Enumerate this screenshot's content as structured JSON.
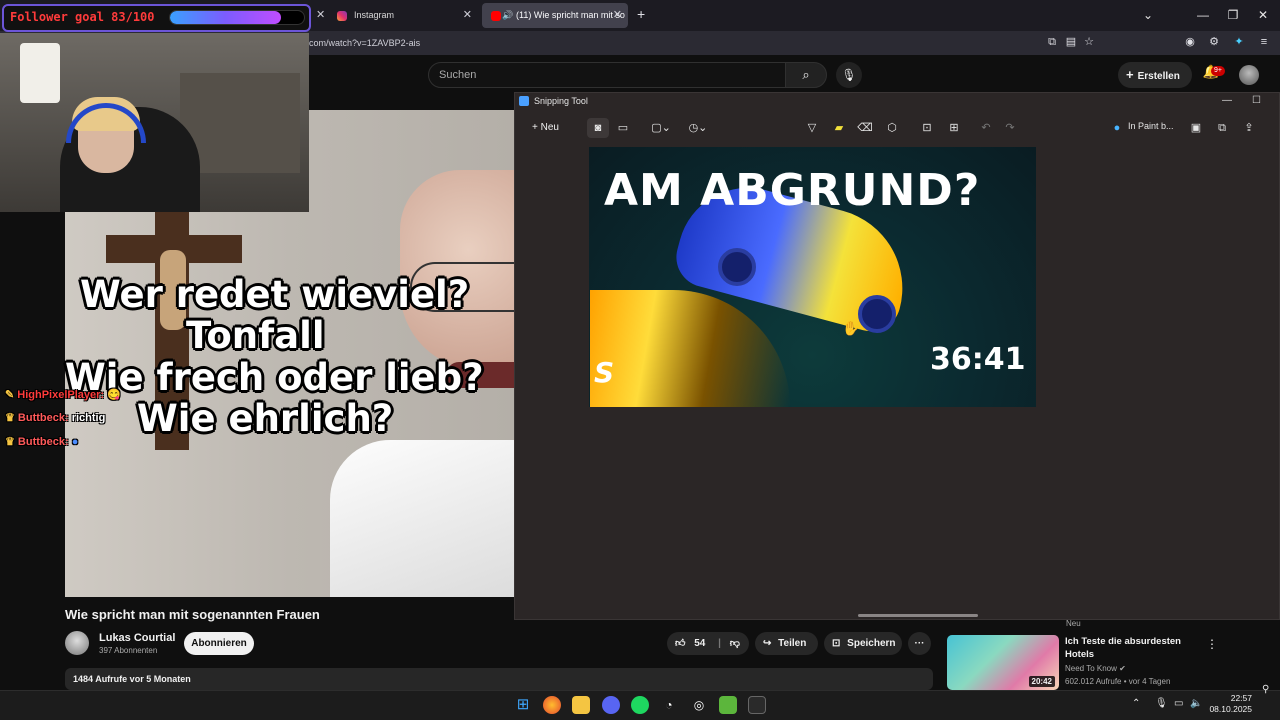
{
  "browser": {
    "tabs": [
      {
        "label": "Instagram",
        "active": false
      },
      {
        "label": "(11) Wie spricht man mit so",
        "active": true
      }
    ],
    "new_tab": "+",
    "url": "com/watch?v=1ZAVBP2-ais",
    "window": {
      "minimize": "—",
      "restore": "❐",
      "close": "✕",
      "tab_list": "⌄"
    }
  },
  "youtube": {
    "search_placeholder": "Suchen",
    "create_label": "Erstellen",
    "notification_count": "9+",
    "video": {
      "title": "Wie spricht man mit sogenannten Frauen",
      "channel": "Lukas Courtial",
      "subscribers": "397 Abonnenten",
      "subscribe_label": "Abonnieren",
      "likes": "54",
      "share_label": "Teilen",
      "save_label": "Speichern",
      "more_label": "···",
      "description_meta": "1484 Aufrufe  vor 5 Monaten"
    },
    "recommendation": {
      "badge": "Neu",
      "title": "Ich Teste die absurdesten Hotels",
      "channel": "Need To Know",
      "meta": "602.012 Aufrufe • vor 4 Tagen",
      "duration": "20:42"
    }
  },
  "overlay": {
    "follower_goal": "Follower goal 83/100",
    "follower_progress": 0.83,
    "questions": [
      "Wer redet wieviel?",
      "Tonfall",
      "Wie frech oder lieb?",
      "Wie ehrlich?"
    ],
    "chat": [
      {
        "user": "HighPixelPlayer:",
        "text": "",
        "color": "#ff3b3b"
      },
      {
        "user": "Buttbeck:",
        "text": "richtig",
        "color": "#ff3b3b"
      },
      {
        "user": "Buttbeck:",
        "text": "",
        "color": "#ff3b3b"
      }
    ]
  },
  "snipping_tool": {
    "title": "Snipping Tool",
    "new_label": "Neu",
    "in_paint_label": "In Paint b...",
    "thumbnail": {
      "headline": "AM ABGRUND?",
      "duration": "36:41",
      "corner_letter": "S"
    }
  },
  "taskbar": {
    "time": "22:57",
    "date": "08.10.2025"
  },
  "colors": {
    "accent_purple": "#6c55d8",
    "youtube_red": "#cc0000",
    "chat_name": "#ff3b3b"
  }
}
